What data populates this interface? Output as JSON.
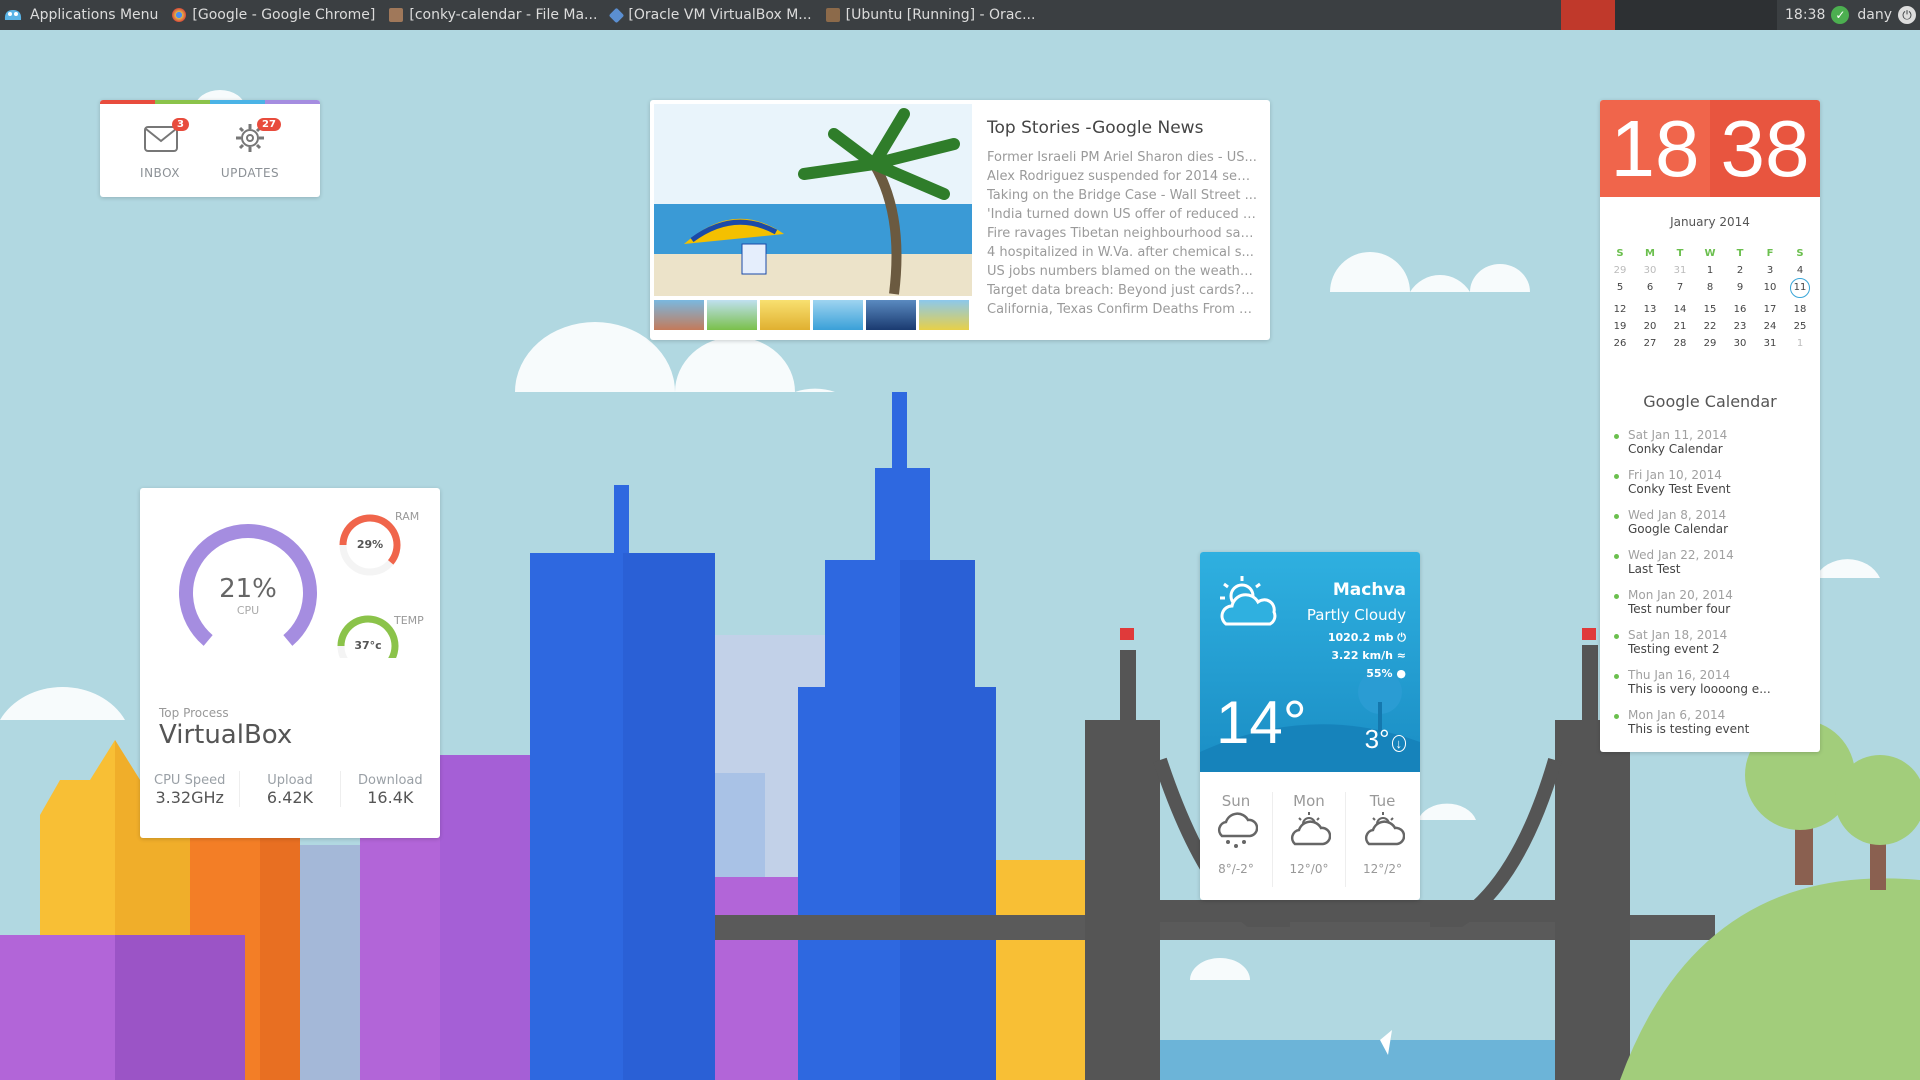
{
  "taskbar": {
    "menu_label": "Applications Menu",
    "windows": [
      {
        "label": "[Google - Google Chrome]",
        "icon": "chrome-icon",
        "color": "#e0b84b"
      },
      {
        "label": "[conky-calendar - File Ma...",
        "icon": "folder-icon",
        "color": "#a0785a"
      },
      {
        "label": "[Oracle VM VirtualBox M...",
        "icon": "virtualbox-icon",
        "color": "#5b8fd1"
      },
      {
        "label": "[Ubuntu [Running] - Orac...",
        "icon": "ubuntu-icon",
        "color": "#8c6a4a"
      }
    ],
    "time": "18:38",
    "user": "dany",
    "active_workspace_color": "#c0392b"
  },
  "notifier": {
    "inbox_label": "INBOX",
    "inbox_count": "3",
    "updates_label": "UPDATES",
    "updates_count": "27"
  },
  "news": {
    "title": "Top Stories -Google News",
    "items": [
      "Former Israeli PM Ariel Sharon dies - US...",
      "Alex Rodriguez suspended for 2014 season...",
      "Taking on the Bridge Case - Wall Street ...",
      "'India turned down US offer of reduced c...",
      "Fire ravages Tibetan neighbourhood said ...",
      "4 hospitalized in W.Va. after chemical s...",
      "US jobs numbers blamed on the weather - ...",
      "Target data breach: Beyond just cards? -...",
      "California, Texas Confirm Deaths From H1..."
    ]
  },
  "sysmon": {
    "cpu_value": "21%",
    "cpu_label": "CPU",
    "cpu_fraction": 0.21,
    "ram_label": "RAM",
    "ram_value": "29%",
    "ram_fraction": 0.29,
    "temp_label": "TEMP",
    "temp_value": "37°c",
    "top_process_label": "Top Process",
    "top_process": "VirtualBox",
    "stats": [
      {
        "label": "CPU Speed",
        "value": "3.32GHz"
      },
      {
        "label": "Upload",
        "value": "6.42K"
      },
      {
        "label": "Download",
        "value": "16.4K"
      }
    ],
    "colors": {
      "cpu": "#a58de0",
      "ram": "#f0654b",
      "temp": "#8bc34a"
    }
  },
  "clock": {
    "hour": "18",
    "minute": "38",
    "hour_bg": "#f0654b",
    "minute_bg": "#e8553f"
  },
  "calendar": {
    "month": "January 2014",
    "weekdays": [
      "S",
      "M",
      "T",
      "W",
      "T",
      "F",
      "S"
    ],
    "days": [
      "29",
      "30",
      "31",
      "1",
      "2",
      "3",
      "4",
      "5",
      "6",
      "7",
      "8",
      "9",
      "10",
      "11",
      "12",
      "13",
      "14",
      "15",
      "16",
      "17",
      "18",
      "19",
      "20",
      "21",
      "22",
      "23",
      "24",
      "25",
      "26",
      "27",
      "28",
      "29",
      "30",
      "31",
      "1"
    ],
    "today": "11",
    "events_title": "Google Calendar",
    "events": [
      {
        "date": "Sat Jan 11, 2014",
        "title": "Conky Calendar"
      },
      {
        "date": "Fri Jan 10, 2014",
        "title": "Conky Test Event"
      },
      {
        "date": "Wed Jan 8, 2014",
        "title": "Google Calendar"
      },
      {
        "date": "Wed Jan 22, 2014",
        "title": "Last Test"
      },
      {
        "date": "Mon Jan 20, 2014",
        "title": "Test number four"
      },
      {
        "date": "Sat Jan 18, 2014",
        "title": "Testing event 2"
      },
      {
        "date": "Thu Jan 16, 2014",
        "title": "This is very loooong e..."
      },
      {
        "date": "Mon Jan 6, 2014",
        "title": "This is testing event"
      }
    ]
  },
  "weather": {
    "city": "Machva",
    "condition": "Partly Cloudy",
    "pressure": "1020.2 mb",
    "wind": "3.22 km/h",
    "humidity": "55%",
    "temp": "14°",
    "low": "3°",
    "forecast": [
      {
        "day": "Sun",
        "temps": "8°/-2°",
        "icon": "rain-cloud-icon"
      },
      {
        "day": "Mon",
        "temps": "12°/0°",
        "icon": "partly-cloudy-icon"
      },
      {
        "day": "Tue",
        "temps": "12°/2°",
        "icon": "partly-cloudy-icon"
      }
    ]
  }
}
